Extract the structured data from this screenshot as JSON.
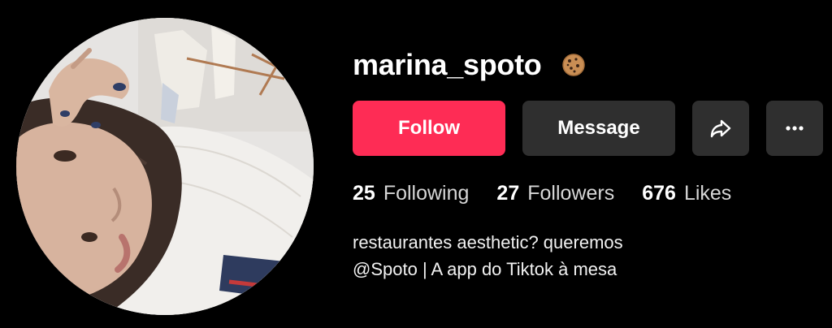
{
  "profile": {
    "username": "marina_spoto",
    "badge_icon": "cookie-icon",
    "avatar_icon": "profile-photo"
  },
  "actions": {
    "follow_label": "Follow",
    "message_label": "Message",
    "share_icon": "share-arrow-icon",
    "more_icon": "more-dots-icon"
  },
  "stats": {
    "following": {
      "count": "25",
      "label": "Following"
    },
    "followers": {
      "count": "27",
      "label": "Followers"
    },
    "likes": {
      "count": "676",
      "label": "Likes"
    }
  },
  "bio": {
    "lines": [
      "restaurantes aesthetic? queremos",
      "@Spoto | A app do Tiktok à mesa"
    ]
  },
  "colors": {
    "background": "#000000",
    "follow_button": "#fe2c55",
    "secondary_button": "#2f2f2f",
    "text": "#ffffff",
    "muted_text": "#d6d6d6"
  }
}
